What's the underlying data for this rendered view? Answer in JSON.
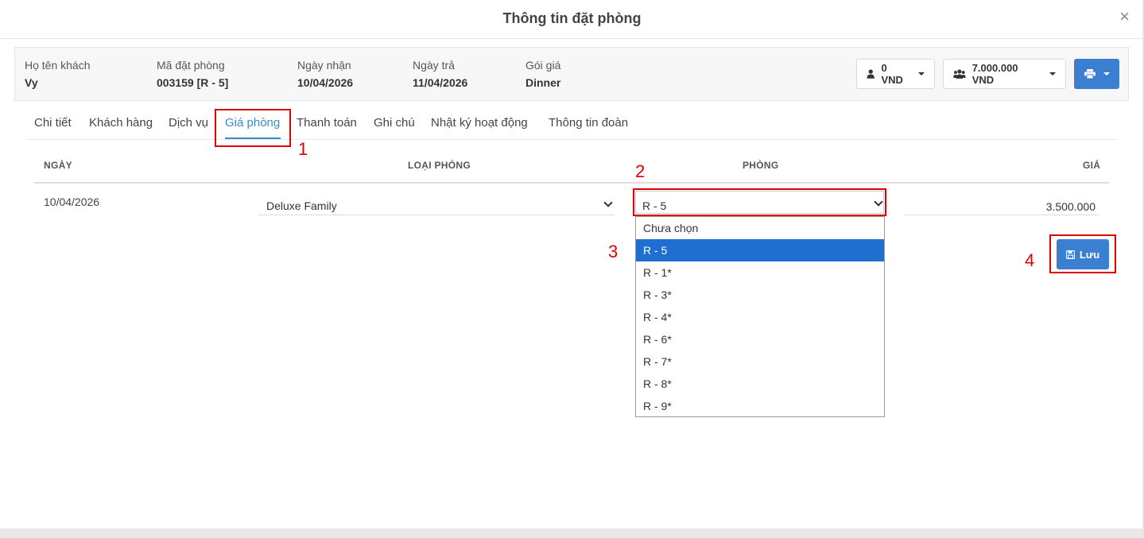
{
  "modal": {
    "title": "Thông tin đặt phòng",
    "close_icon": "×"
  },
  "info": {
    "guest_label": "Họ tên khách",
    "guest_value": "Vy",
    "booking_label": "Mã đặt phòng",
    "booking_value": "003159 [R - 5]",
    "checkin_label": "Ngày nhận",
    "checkin_value": "10/04/2026",
    "checkout_label": "Ngày trả",
    "checkout_value": "11/04/2026",
    "rate_label": "Gói giá",
    "rate_value": "Dinner"
  },
  "toolbar": {
    "person_amount": "0 VND",
    "group_amount": "7.000.000 VND"
  },
  "tabs": [
    {
      "label": "Chi tiết"
    },
    {
      "label": "Khách hàng"
    },
    {
      "label": "Dịch vụ"
    },
    {
      "label": "Giá phòng"
    },
    {
      "label": "Thanh toán"
    },
    {
      "label": "Ghi chú"
    },
    {
      "label": "Nhật ký hoạt động"
    },
    {
      "label": "Thông tin đoàn"
    }
  ],
  "table": {
    "headers": [
      "NGÀY",
      "LOẠI PHÒNG",
      "PHÒNG",
      "GIÁ"
    ],
    "row": {
      "date": "10/04/2026",
      "room_type": "Deluxe Family",
      "room": "R - 5",
      "price": "3.500.000"
    }
  },
  "room_options": [
    "Chưa chọn",
    "R - 5",
    "R - 1*",
    "R - 3*",
    "R - 4*",
    "R - 6*",
    "R - 7*",
    "R - 8*",
    "R - 9*"
  ],
  "selected_room": "R - 5",
  "save_label": "Lưu",
  "annotations": [
    "1",
    "2",
    "3",
    "4"
  ],
  "colors": {
    "accent": "#3b7fd0",
    "tab_active": "#3b8bc9",
    "highlight": "#e00000",
    "option_selected": "#1f6fd0"
  }
}
